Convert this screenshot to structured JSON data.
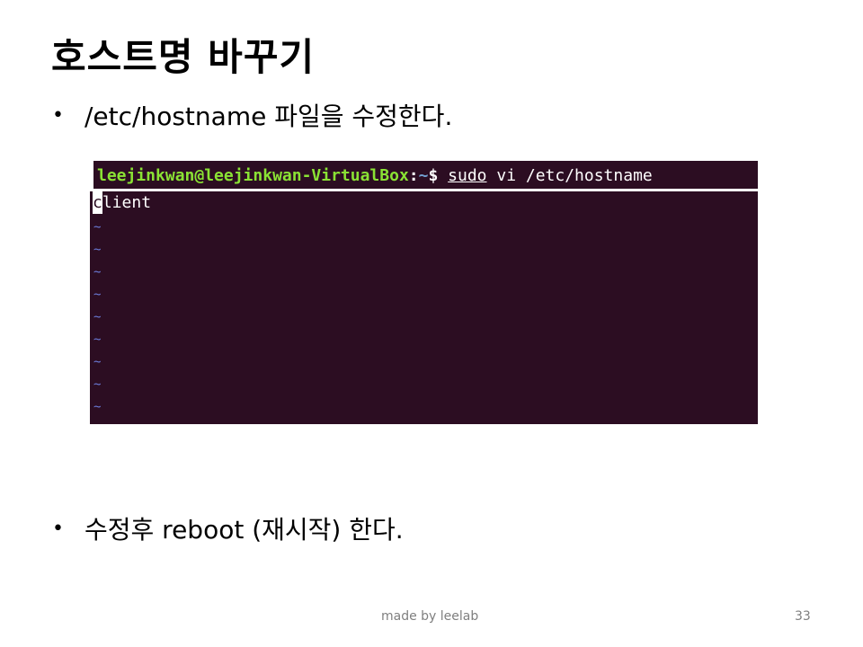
{
  "slide": {
    "title": "호스트명 바꾸기",
    "bullets": [
      "/etc/hostname 파일을 수정한다.",
      "수정후 reboot (재시작) 한다."
    ],
    "bullet_glyph": "•"
  },
  "terminal": {
    "user_host": "leejinkwan@leejinkwan-VirtualBox",
    "separator": ":",
    "cwd": "~",
    "prompt_symbol": "$ ",
    "command_first": "sudo",
    "command_rest": " vi /etc/hostname",
    "file_content_first_char": "c",
    "file_content_rest": "lient",
    "empty_line_marker": "~",
    "colors": {
      "background": "#2c0d22",
      "user_host": "#8ae234",
      "path": "#729fcf",
      "tilde": "#6b7bd8"
    }
  },
  "footer": {
    "text": "made by leelab",
    "page_number": "33"
  }
}
